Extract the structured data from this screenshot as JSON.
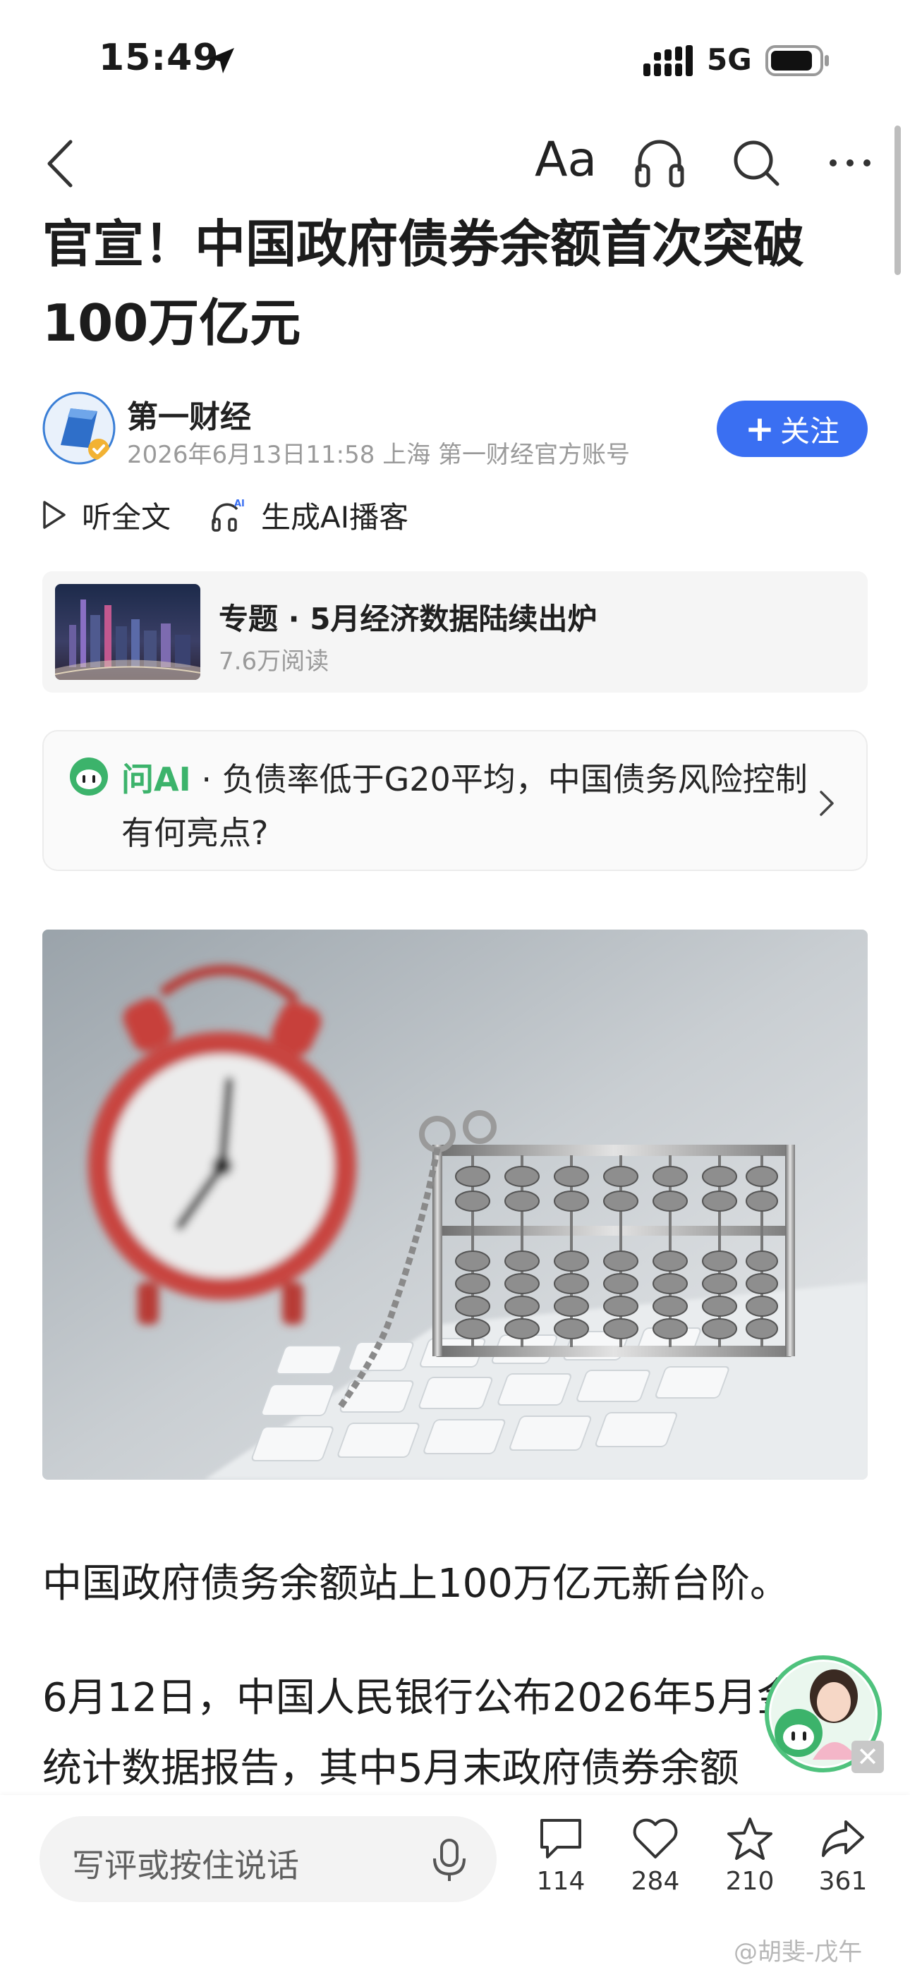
{
  "status_bar": {
    "time": "15:49",
    "network": "5G"
  },
  "nav": {
    "font_label": "Aa"
  },
  "article": {
    "title": "官宣！中国政府债券余额首次突破100万亿元",
    "author": {
      "name": "第一财经",
      "meta": "2026年6月13日11:58 上海 第一财经官方账号"
    },
    "follow_label": "关注",
    "listen_label": "听全文",
    "podcast_label": "生成AI播客",
    "topic": {
      "title": "专题 · 5月经济数据陆续出炉",
      "reads": "7.6万阅读"
    },
    "ask_ai": {
      "label": "问AI",
      "question": " · 负债率低于G20平均，中国债务风险控制有何亮点?"
    },
    "paragraphs": [
      "中国政府债务余额站上100万亿元新台阶。",
      "6月12日，中国人民银行公布2026年5月金融统计数据报告，其中5月末政府债券余额"
    ]
  },
  "bottom_bar": {
    "comment_placeholder": "写评或按住说话",
    "comments": "114",
    "likes": "284",
    "favorites": "210",
    "shares": "361"
  },
  "watermark": "@胡斐-戊午",
  "colors": {
    "accent": "#3a6ff2",
    "ai_green": "#3cb36b"
  },
  "icons": [
    "location-arrow-icon",
    "signal-icon",
    "battery-icon",
    "back-icon",
    "headphones-icon",
    "search-icon",
    "more-icon",
    "play-icon",
    "ai-headphones-icon",
    "ai-assistant-icon",
    "chevron-right-icon",
    "mic-icon",
    "comment-icon",
    "heart-icon",
    "star-icon",
    "share-icon",
    "close-icon"
  ]
}
